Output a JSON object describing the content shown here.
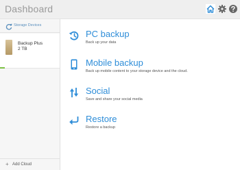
{
  "app": {
    "title": "Dashboard"
  },
  "toolbar": {
    "home_icon": "home-icon",
    "settings_icon": "gear-icon",
    "help_icon": "help-icon",
    "accent_color": "#2e8dd8"
  },
  "sidebar": {
    "header": {
      "label": "Storage Devices",
      "icon": "refresh-icon"
    },
    "device": {
      "name": "Backup Plus",
      "size": "2 TB",
      "icon": "drive-icon",
      "status_color": "#7cc043"
    },
    "footer": {
      "label": "Add Cloud",
      "icon": "plus-icon"
    }
  },
  "menu": [
    {
      "title": "PC backup",
      "subtitle": "Back up your data",
      "icon": "history-icon"
    },
    {
      "title": "Mobile backup",
      "subtitle": "Back up mobile content to your storage device and the cloud.",
      "icon": "phone-icon"
    },
    {
      "title": "Social",
      "subtitle": "Save and share your social media",
      "icon": "transfer-icon"
    },
    {
      "title": "Restore",
      "subtitle": "Restore a backup",
      "icon": "return-arrow-icon"
    }
  ]
}
